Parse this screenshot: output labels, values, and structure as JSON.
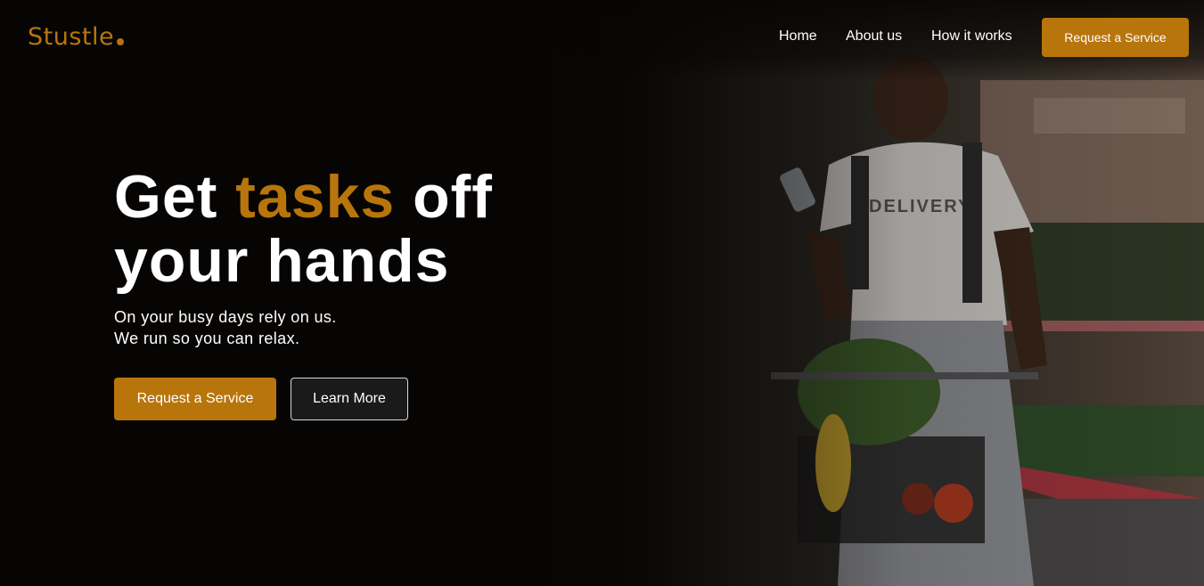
{
  "brand": {
    "name": "Stustle",
    "accent_color": "#b8750c"
  },
  "nav": {
    "items": [
      {
        "label": "Home"
      },
      {
        "label": "About us"
      },
      {
        "label": "How it works"
      }
    ],
    "cta_label": "Request a Service"
  },
  "hero": {
    "headline_part1": "Get ",
    "headline_accent": "tasks",
    "headline_part2": " off",
    "headline_line2": "your hands",
    "subtitle_line1": "On your busy days rely on us.",
    "subtitle_line2": "We run so you can relax.",
    "primary_button": "Request a Service",
    "secondary_button": "Learn More",
    "image": {
      "description_icon": "delivery-person-photo",
      "shirt_text": "DELIVERY"
    }
  }
}
